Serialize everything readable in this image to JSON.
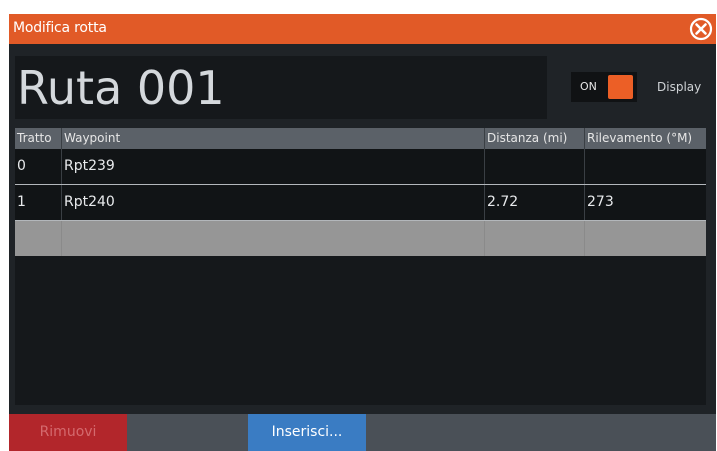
{
  "window": {
    "title": "Modifica rotta"
  },
  "route": {
    "name": "Ruta 001",
    "toggle_state": "ON",
    "display_label": "Display"
  },
  "table": {
    "headers": [
      "Tratto",
      "Waypoint",
      "Distanza (mi)",
      "Rilevamento (°M)"
    ],
    "rows": [
      {
        "leg": "0",
        "waypoint": "Rpt239",
        "distance": "",
        "bearing": ""
      },
      {
        "leg": "1",
        "waypoint": "Rpt240",
        "distance": "2.72",
        "bearing": "273"
      }
    ]
  },
  "buttons": {
    "remove": "Rimuovi",
    "insert": "Inserisci..."
  },
  "colors": {
    "accent": "#e15a27",
    "toggle_on": "#ec5f26",
    "remove_button": "#b2262b",
    "insert_button": "#3a7cc3"
  }
}
